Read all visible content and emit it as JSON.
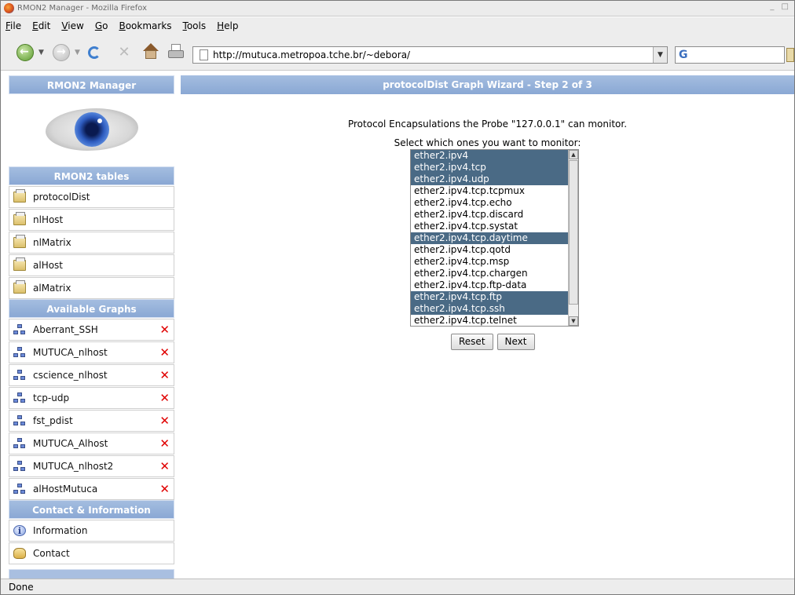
{
  "window": {
    "title": "RMON2 Manager - Mozilla Firefox",
    "controls": "_ □"
  },
  "menubar": {
    "items": [
      {
        "first": "F",
        "rest": "ile"
      },
      {
        "first": "E",
        "rest": "dit"
      },
      {
        "first": "V",
        "rest": "iew"
      },
      {
        "first": "G",
        "rest": "o"
      },
      {
        "first": "B",
        "rest": "ookmarks"
      },
      {
        "first": "T",
        "rest": "ools"
      },
      {
        "first": "H",
        "rest": "elp"
      }
    ]
  },
  "toolbar": {
    "url": "http://mutuca.metropoa.tche.br/~debora/",
    "search_value": ""
  },
  "sidebar": {
    "header": "RMON2 Manager",
    "tables_header": "RMON2 tables",
    "tables": [
      "protocolDist",
      "nlHost",
      "nlMatrix",
      "alHost",
      "alMatrix"
    ],
    "graphs_header": "Available Graphs",
    "graphs": [
      "Aberrant_SSH",
      "MUTUCA_nlhost",
      "cscience_nlhost",
      "tcp-udp",
      "fst_pdist",
      "MUTUCA_Alhost",
      "MUTUCA_nlhost2",
      "alHostMutuca"
    ],
    "contact_header": "Contact & Information",
    "contact_items": [
      "Information",
      "Contact"
    ],
    "delete_glyph": "✕",
    "info_glyph": "i"
  },
  "main": {
    "header": "protocolDist Graph Wizard - Step 2 of 3",
    "description": "Protocol Encapsulations the Probe \"127.0.0.1\" can monitor.",
    "select_label": "Select which ones you want to monitor:",
    "options": [
      {
        "label": "ether2.ipv4",
        "selected": true
      },
      {
        "label": "ether2.ipv4.tcp",
        "selected": true
      },
      {
        "label": "ether2.ipv4.udp",
        "selected": true
      },
      {
        "label": "ether2.ipv4.tcp.tcpmux",
        "selected": false
      },
      {
        "label": "ether2.ipv4.tcp.echo",
        "selected": false
      },
      {
        "label": "ether2.ipv4.tcp.discard",
        "selected": false
      },
      {
        "label": "ether2.ipv4.tcp.systat",
        "selected": false
      },
      {
        "label": "ether2.ipv4.tcp.daytime",
        "selected": true
      },
      {
        "label": "ether2.ipv4.tcp.qotd",
        "selected": false
      },
      {
        "label": "ether2.ipv4.tcp.msp",
        "selected": false
      },
      {
        "label": "ether2.ipv4.tcp.chargen",
        "selected": false
      },
      {
        "label": "ether2.ipv4.tcp.ftp-data",
        "selected": false
      },
      {
        "label": "ether2.ipv4.tcp.ftp",
        "selected": true
      },
      {
        "label": "ether2.ipv4.tcp.ssh",
        "selected": true
      },
      {
        "label": "ether2.ipv4.tcp.telnet",
        "selected": false
      }
    ],
    "reset_label": "Reset",
    "next_label": "Next"
  },
  "statusbar": {
    "text": "Done"
  },
  "colors": {
    "header_blue": "#8aa8d4",
    "selected_option": "#4a6a85",
    "delete_red": "#e00000"
  }
}
